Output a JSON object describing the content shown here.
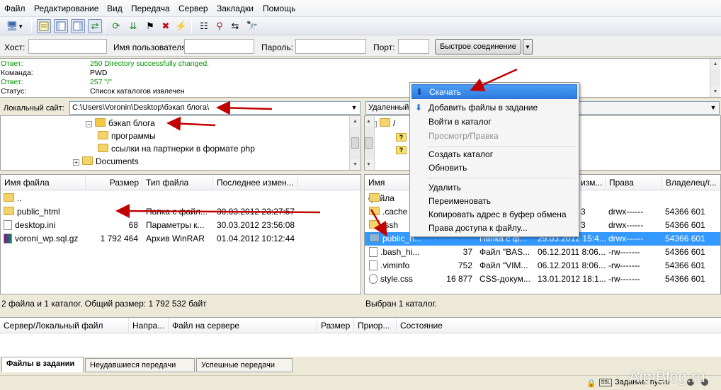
{
  "menu": [
    "Файл",
    "Редактирование",
    "Вид",
    "Передача",
    "Сервер",
    "Закладки",
    "Помощь"
  ],
  "quickconnect": {
    "host_label": "Хост:",
    "user_label": "Имя пользователя",
    "pass_label": "Пароль:",
    "port_label": "Порт:",
    "button_label": "Быстрое соединение"
  },
  "log": [
    {
      "label": "Ответ:",
      "text": "250 Directory successfully changed.",
      "green": true
    },
    {
      "label": "Команда:",
      "text": "PWD",
      "green": false
    },
    {
      "label": "Ответ:",
      "text": "257 \"/\"",
      "green": true
    },
    {
      "label": "Статус:",
      "text": "Список каталогов извлечен",
      "green": false
    }
  ],
  "local": {
    "site_label": "Локальный сайт:",
    "path": "C:\\Users\\Voronin\\Desktop\\бэкап блога\\",
    "tree": [
      {
        "name": "бэкап блога",
        "expanded": true
      },
      {
        "name": "программы",
        "expanded": false
      },
      {
        "name": "ссылки на партнерки в формате php",
        "expanded": false
      },
      {
        "name": "Documents",
        "expanded": true
      }
    ],
    "columns": [
      "Имя файла",
      "Размер",
      "Тип файла",
      "Последнее измен..."
    ],
    "files": [
      {
        "name": "..",
        "size": "",
        "type": "",
        "modified": ""
      },
      {
        "name": "public_html",
        "size": "",
        "type": "Папка с файл...",
        "modified": "30.03.2012 23:27:57"
      },
      {
        "name": "desktop.ini",
        "size": "68",
        "type": "Параметры к...",
        "modified": "30.03.2012 23:56:08"
      },
      {
        "name": "voroni_wp.sql.gz",
        "size": "1 792 464",
        "type": "Архив WinRAR",
        "modified": "01.04.2012 10:12:44"
      }
    ],
    "status": "2 файла и 1 каталог. Общий размер: 1 792 532 байт"
  },
  "remote": {
    "site_label": "Удаленный",
    "tree_root": "/",
    "columns": [
      "Имя файла",
      "изм...",
      "Права",
      "Владелец/г..."
    ],
    "files": [
      {
        "name": "..",
        "size": "",
        "type": "",
        "modified": "",
        "perms": "",
        "owner": ""
      },
      {
        "name": ".cache",
        "size": "",
        "type": "",
        "modified": "3",
        "perms": "drwx------",
        "owner": "54366 601"
      },
      {
        "name": ".ssh",
        "size": "",
        "type": "",
        "modified": "3",
        "perms": "drwx------",
        "owner": "54366 601"
      },
      {
        "name": "public_h...",
        "size": "",
        "type": "Папка с ф...",
        "modified": "29.03.2012 15:4...",
        "perms": "drwx------",
        "owner": "54366 601",
        "selected": true
      },
      {
        "name": ".bash_hi...",
        "size": "37",
        "type": "Файл \"BAS...",
        "modified": "06.12.2011 8:06...",
        "perms": "-rw-------",
        "owner": "54366 601"
      },
      {
        "name": ".viminfo",
        "size": "752",
        "type": "Файл \"VIM...",
        "modified": "06.12.2011 8:06...",
        "perms": "-rw-------",
        "owner": "54366 601"
      },
      {
        "name": "style.css",
        "size": "16 877",
        "type": "CSS-докум...",
        "modified": "13.01.2012 18:1...",
        "perms": "-rw-------",
        "owner": "54366 601"
      }
    ],
    "status": "Выбран 1 каталог."
  },
  "context_menu": [
    {
      "label": "Скачать",
      "highlight": true
    },
    {
      "label": "Добавить файлы в задание"
    },
    {
      "label": "Войти в каталог"
    },
    {
      "label": "Просмотр/Правка",
      "disabled": true
    },
    {
      "sep": true
    },
    {
      "label": "Создать каталог"
    },
    {
      "label": "Обновить"
    },
    {
      "sep": true
    },
    {
      "label": "Удалить"
    },
    {
      "label": "Переименовать"
    },
    {
      "label": "Копировать адрес в буфер обмена"
    },
    {
      "label": "Права доступа к файлу..."
    }
  ],
  "queue": {
    "columns": [
      "Сервер/Локальный файл",
      "Напра...",
      "Файл на сервере",
      "Размер",
      "Приор...",
      "Состояние"
    ],
    "tabs": [
      "Файлы в задании",
      "Неудавшиеся передачи",
      "Успешные передачи"
    ],
    "status_right": "Задание: пусто"
  },
  "watermark": "AimBlog.ru",
  "colors": {
    "selection": "#3399ff",
    "arrow": "#c00000",
    "log_green": "#009200"
  }
}
